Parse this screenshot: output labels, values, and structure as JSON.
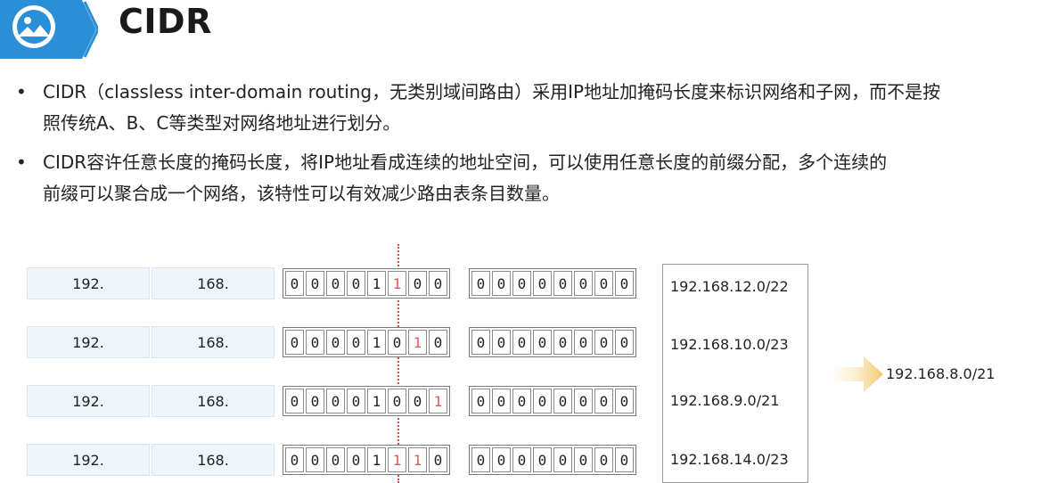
{
  "header": {
    "title": "CIDR",
    "icon": "image-icon",
    "accent_color": "#2a8fd6"
  },
  "bullets": [
    {
      "line1": "CIDR（classless inter-domain routing，无类别域间路由）采用IP地址加掩码长度来标识网络和子网，而不是按",
      "line2": "照传统A、B、C等类型对网络地址进行划分。"
    },
    {
      "line1": "CIDR容许任意长度的掩码长度，将IP地址看成连续的地址空间，可以使用任意长度的前缀分配，多个连续的",
      "line2": "前缀可以聚合成一个网络，该特性可以有效减少路由表条目数量。"
    }
  ],
  "bullet_symbol": "•",
  "diagram": {
    "rows": [
      {
        "octet1": "192.",
        "octet2": "168.",
        "bits3": [
          "0",
          "0",
          "0",
          "0",
          "1",
          "1",
          "0",
          "0"
        ],
        "red3": [
          5
        ],
        "bits4": [
          "0",
          "0",
          "0",
          "0",
          "0",
          "0",
          "0",
          "0"
        ],
        "cidr": "192.168.12.0/22"
      },
      {
        "octet1": "192.",
        "octet2": "168.",
        "bits3": [
          "0",
          "0",
          "0",
          "0",
          "1",
          "0",
          "1",
          "0"
        ],
        "red3": [
          6
        ],
        "bits4": [
          "0",
          "0",
          "0",
          "0",
          "0",
          "0",
          "0",
          "0"
        ],
        "cidr": "192.168.10.0/23"
      },
      {
        "octet1": "192.",
        "octet2": "168.",
        "bits3": [
          "0",
          "0",
          "0",
          "0",
          "1",
          "0",
          "0",
          "1"
        ],
        "red3": [
          7
        ],
        "bits4": [
          "0",
          "0",
          "0",
          "0",
          "0",
          "0",
          "0",
          "0"
        ],
        "cidr": "192.168.9.0/21"
      },
      {
        "octet1": "192.",
        "octet2": "168.",
        "bits3": [
          "0",
          "0",
          "0",
          "0",
          "1",
          "1",
          "1",
          "0"
        ],
        "red3": [
          5,
          6
        ],
        "bits4": [
          "0",
          "0",
          "0",
          "0",
          "0",
          "0",
          "0",
          "0"
        ],
        "cidr": "192.168.14.0/23"
      }
    ],
    "result": "192.168.8.0/21",
    "arrow_icon": "arrow-right-icon",
    "highlight_color": "#e05555"
  }
}
